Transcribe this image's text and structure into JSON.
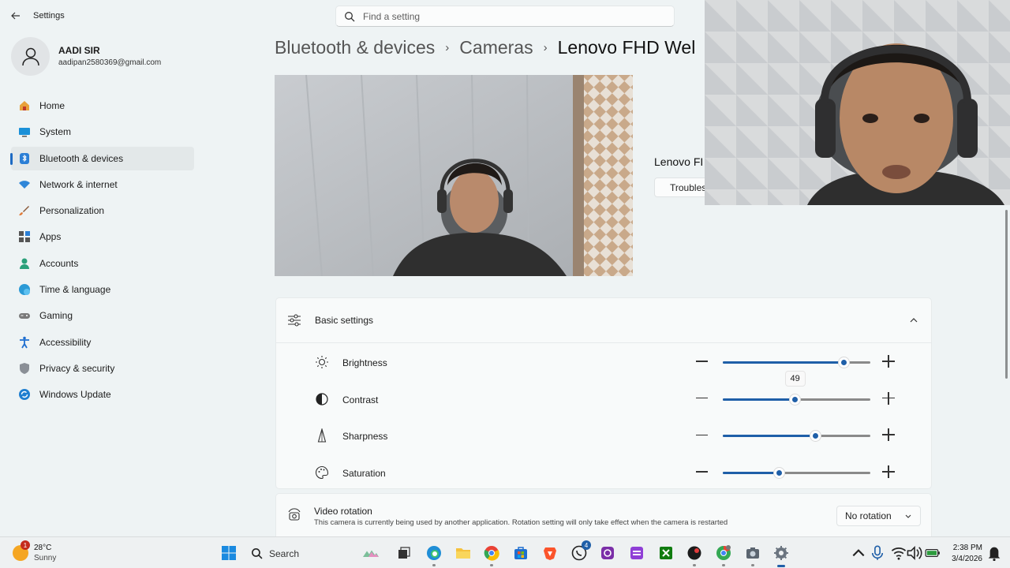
{
  "window": {
    "title": "Settings"
  },
  "search": {
    "placeholder": "Find a setting"
  },
  "profile": {
    "name": "AADI SIR",
    "email": "aadipan2580369@gmail.com"
  },
  "sidebar": {
    "items": [
      {
        "label": "Home",
        "icon": "home-icon",
        "active": false
      },
      {
        "label": "System",
        "icon": "system-icon",
        "active": false
      },
      {
        "label": "Bluetooth & devices",
        "icon": "bluetooth-icon",
        "active": true
      },
      {
        "label": "Network & internet",
        "icon": "wifi-icon",
        "active": false
      },
      {
        "label": "Personalization",
        "icon": "brush-icon",
        "active": false
      },
      {
        "label": "Apps",
        "icon": "apps-icon",
        "active": false
      },
      {
        "label": "Accounts",
        "icon": "accounts-icon",
        "active": false
      },
      {
        "label": "Time & language",
        "icon": "globe-clock-icon",
        "active": false
      },
      {
        "label": "Gaming",
        "icon": "gamepad-icon",
        "active": false
      },
      {
        "label": "Accessibility",
        "icon": "accessibility-icon",
        "active": false
      },
      {
        "label": "Privacy & security",
        "icon": "shield-icon",
        "active": false
      },
      {
        "label": "Windows Update",
        "icon": "update-icon",
        "active": false
      }
    ]
  },
  "breadcrumb": {
    "items": [
      "Bluetooth & devices",
      "Cameras",
      "Lenovo FHD Wel"
    ],
    "separator": "›"
  },
  "camera": {
    "device_name": "Lenovo FI",
    "troubleshoot_label": "Troublesl"
  },
  "basic_settings": {
    "title": "Basic settings",
    "sliders": [
      {
        "label": "Brightness",
        "icon": "brightness-icon",
        "value": 49,
        "fill": 0.82,
        "show_tooltip": true
      },
      {
        "label": "Contrast",
        "icon": "contrast-icon",
        "value": 50,
        "fill": 0.49,
        "show_tooltip": false
      },
      {
        "label": "Sharpness",
        "icon": "sharpness-icon",
        "value": 63,
        "fill": 0.63,
        "show_tooltip": false
      },
      {
        "label": "Saturation",
        "icon": "saturation-icon",
        "value": 38,
        "fill": 0.38,
        "show_tooltip": false
      }
    ]
  },
  "video_rotation": {
    "title": "Video rotation",
    "description": "This camera is currently being used by another application. Rotation setting will only take effect when the camera is restarted",
    "selected": "No rotation"
  },
  "taskbar": {
    "weather_temp": "28°C",
    "weather_condition": "Sunny",
    "weather_badge": "1",
    "search_label": "Search",
    "whatsapp_badge": "4",
    "time": "2:38 PM",
    "date": "3/4/2026"
  },
  "colors": {
    "accent": "#1f5fa8",
    "background": "#eef3f4"
  }
}
